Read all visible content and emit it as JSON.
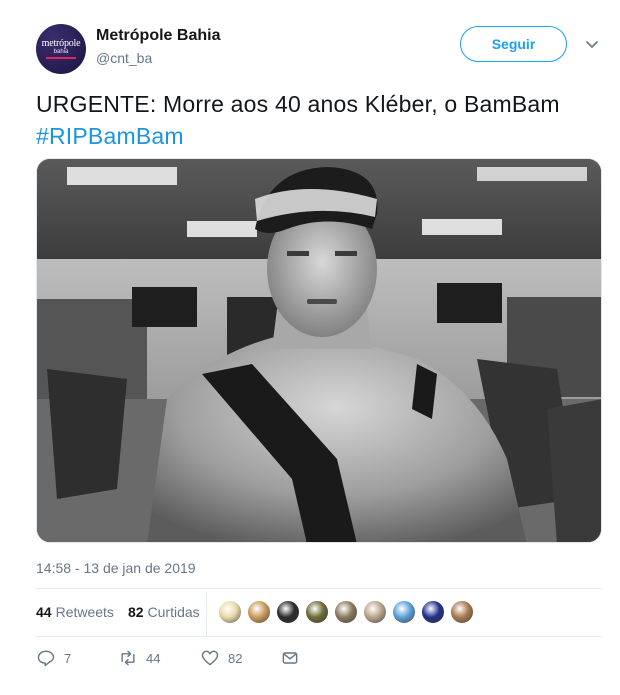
{
  "account": {
    "name": "Metrópole Bahia",
    "handle": "@cnt_ba",
    "avatar_logo_main": "metrópole",
    "avatar_logo_sub": "bahia"
  },
  "follow_button": {
    "label": "Seguir"
  },
  "tweet": {
    "text": "URGENTE: Morre aos 40 anos Kléber, o BamBam",
    "hashtag": "#RIPBamBam",
    "timestamp": "14:58 - 13 de jan de 2019"
  },
  "stats": {
    "retweets_count": "44",
    "retweets_label": "Retweets",
    "likes_count": "82",
    "likes_label": "Curtidas"
  },
  "actions": {
    "reply_count": "7",
    "retweet_count": "44",
    "like_count": "82"
  },
  "likers": [
    "#e9d9a8",
    "#c89a5a",
    "#2b2b2b",
    "#6e6a3a",
    "#8a7a5e",
    "#b9a48a",
    "#5aa0d8",
    "#20308c",
    "#a87a4e"
  ],
  "colors": {
    "accent": "#1da1f2",
    "hashtag": "#1b95e0",
    "muted": "#657786"
  }
}
